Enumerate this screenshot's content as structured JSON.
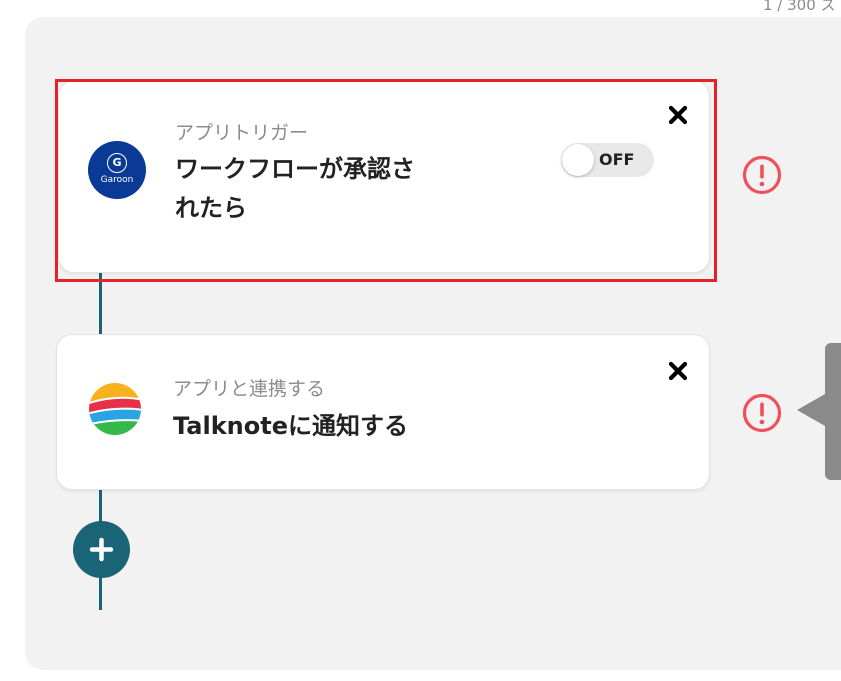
{
  "header": {
    "counter_text": "1 / 300 ス"
  },
  "flow": {
    "trigger": {
      "subtitle": "アプリトリガー",
      "title": "ワークフローが承認さ\nれたら",
      "app_icon": "garoon-logo",
      "app_icon_badge": "G",
      "app_icon_word": "Garoon",
      "toggle_label": "OFF",
      "toggle_state": "off",
      "close_icon": "close-icon",
      "alert_icon": "exclamation-circle-icon"
    },
    "action": {
      "subtitle": "アプリと連携する",
      "title": "Talknoteに通知する",
      "app_icon": "talknote-logo",
      "close_icon": "close-icon",
      "alert_icon": "exclamation-circle-icon"
    },
    "add_button": {
      "icon": "plus-icon"
    }
  },
  "colors": {
    "panel_bg": "#f2f2f2",
    "connector": "#1a6478",
    "add_button": "#1a6478",
    "highlight": "#e5212a",
    "alert": "#f0505a",
    "garoon_blue": "#0a3a96",
    "side_panel": "#8a8a8a"
  }
}
